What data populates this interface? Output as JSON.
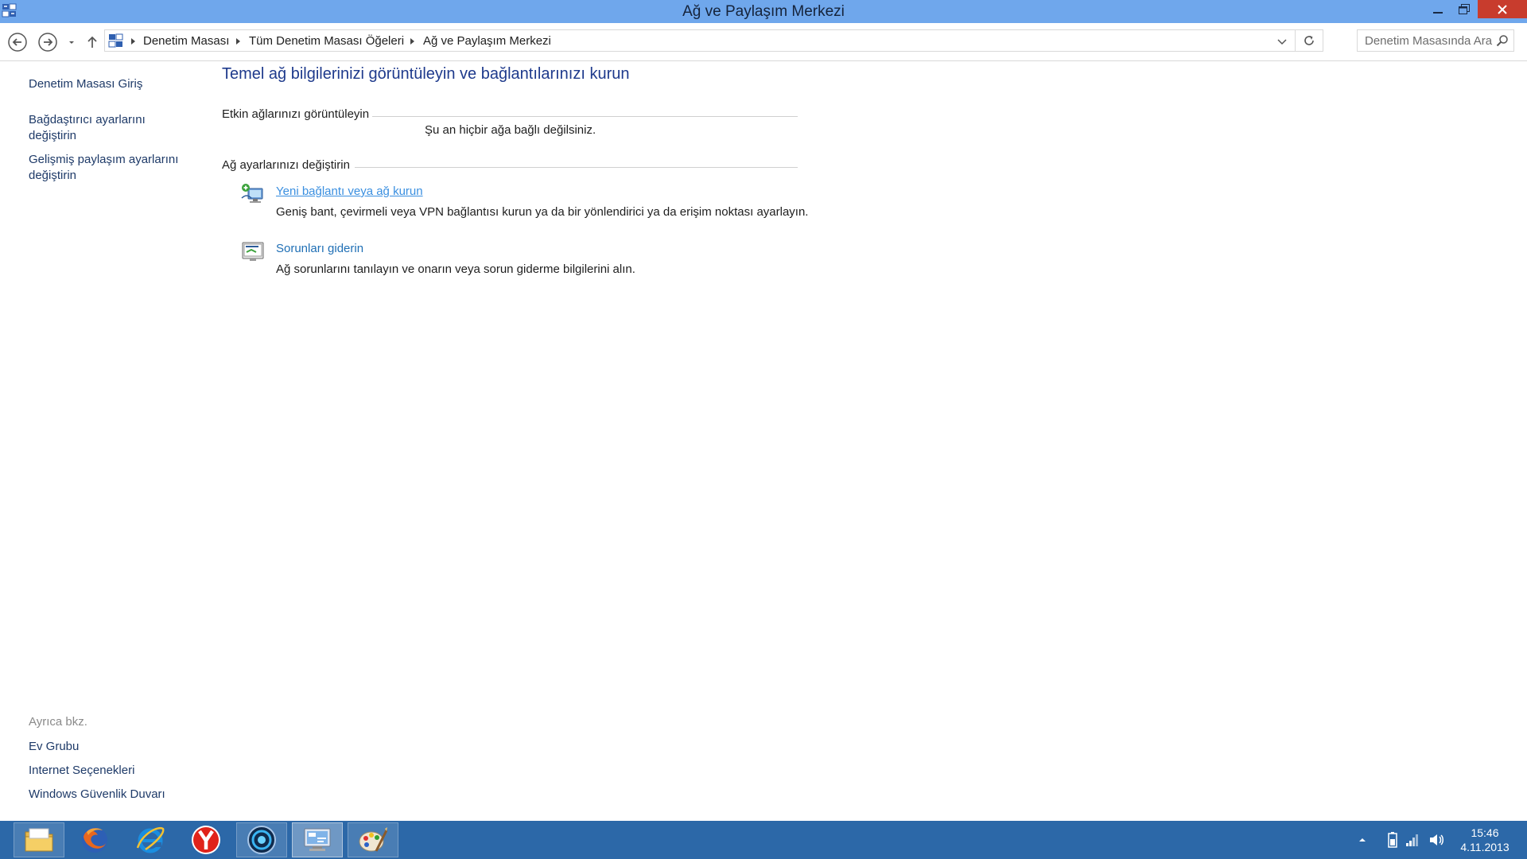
{
  "window": {
    "title": "Ağ ve Paylaşım Merkezi",
    "controls": [
      "minimize",
      "maximize",
      "close"
    ],
    "accent_color": "#6fa7ec",
    "close_color": "#c83c2d"
  },
  "navbar": {
    "breadcrumb": [
      "Denetim Masası",
      "Tüm Denetim Masası Öğeleri",
      "Ağ ve Paylaşım Merkezi"
    ],
    "search_placeholder": "Denetim Masasında Ara"
  },
  "leftpane": {
    "home": "Denetim Masası Giriş",
    "links": [
      {
        "line1": "Bağdaştırıcı ayarlarını",
        "line2": "değiştirin"
      },
      {
        "line1": "Gelişmiş paylaşım ayarlarını",
        "line2": "değiştirin"
      }
    ],
    "see_also_label": "Ayrıca bkz.",
    "see_also": [
      "Ev Grubu",
      "Internet Seçenekleri",
      "Windows Güvenlik Duvarı"
    ]
  },
  "main": {
    "title": "Temel ağ bilgilerinizi görüntüleyin ve bağlantılarınızı kurun",
    "active_networks_label": "Etkin ağlarınızı görüntüleyin",
    "no_network_text": "Şu an hiçbir ağa bağlı değilsiniz.",
    "change_settings_label": "Ağ ayarlarınızı değiştirin",
    "tasks": [
      {
        "icon": "network-setup-icon",
        "title": "Yeni bağlantı veya ağ kurun",
        "description": "Geniş bant, çevirmeli veya VPN bağlantısı kurun ya da bir yönlendirici ya da erişim noktası ayarlayın."
      },
      {
        "icon": "troubleshoot-icon",
        "title": "Sorunları giderin",
        "description": "Ağ sorunlarını tanılayın ve onarın veya sorun giderme bilgilerini alın."
      }
    ]
  },
  "taskbar": {
    "apps": [
      "file-explorer-icon",
      "firefox-icon",
      "internet-explorer-icon",
      "yandex-browser-icon",
      "media-player-icon",
      "control-panel-icon",
      "paint-icon"
    ],
    "active_app": "control-panel-icon",
    "tray": [
      "show-hidden-icons-icon",
      "battery-icon",
      "network-icon",
      "volume-icon"
    ],
    "time": "15:46",
    "date": "4.11.2013",
    "color": "#2c68a8"
  }
}
